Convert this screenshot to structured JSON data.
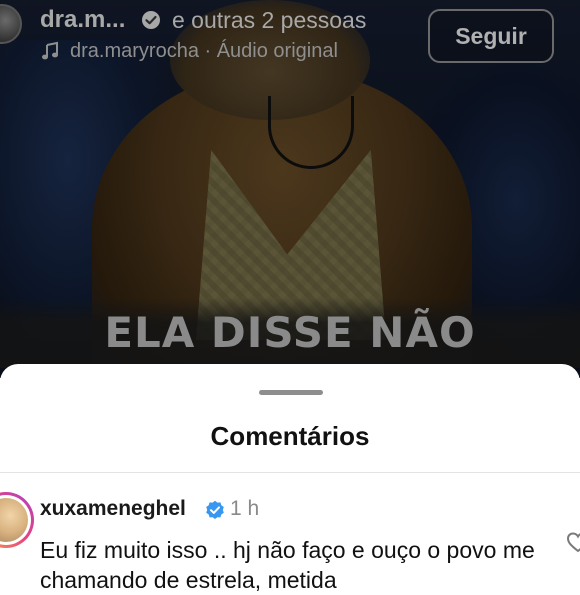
{
  "header": {
    "author_name": "dra.m...",
    "others_text": "e outras 2 pessoas",
    "audio_text": "dra.maryrocha · Áudio original",
    "follow_label": "Seguir"
  },
  "video": {
    "caption": "ELA DISSE NÃO"
  },
  "comments_sheet": {
    "title": "Comentários",
    "comments": [
      {
        "username": "xuxameneghel",
        "verified": true,
        "time": "1 h",
        "text": "Eu fiz muito isso .. hj não faço e  ouço o povo me chamando de estrela, metida"
      }
    ]
  },
  "colors": {
    "verified_blue": "#3897f0",
    "video_bg": "#121a2e",
    "sheet_bg": "#ffffff"
  },
  "icons": {
    "verified": "verified-badge-icon",
    "music": "music-note-icon",
    "like": "heart-icon"
  }
}
